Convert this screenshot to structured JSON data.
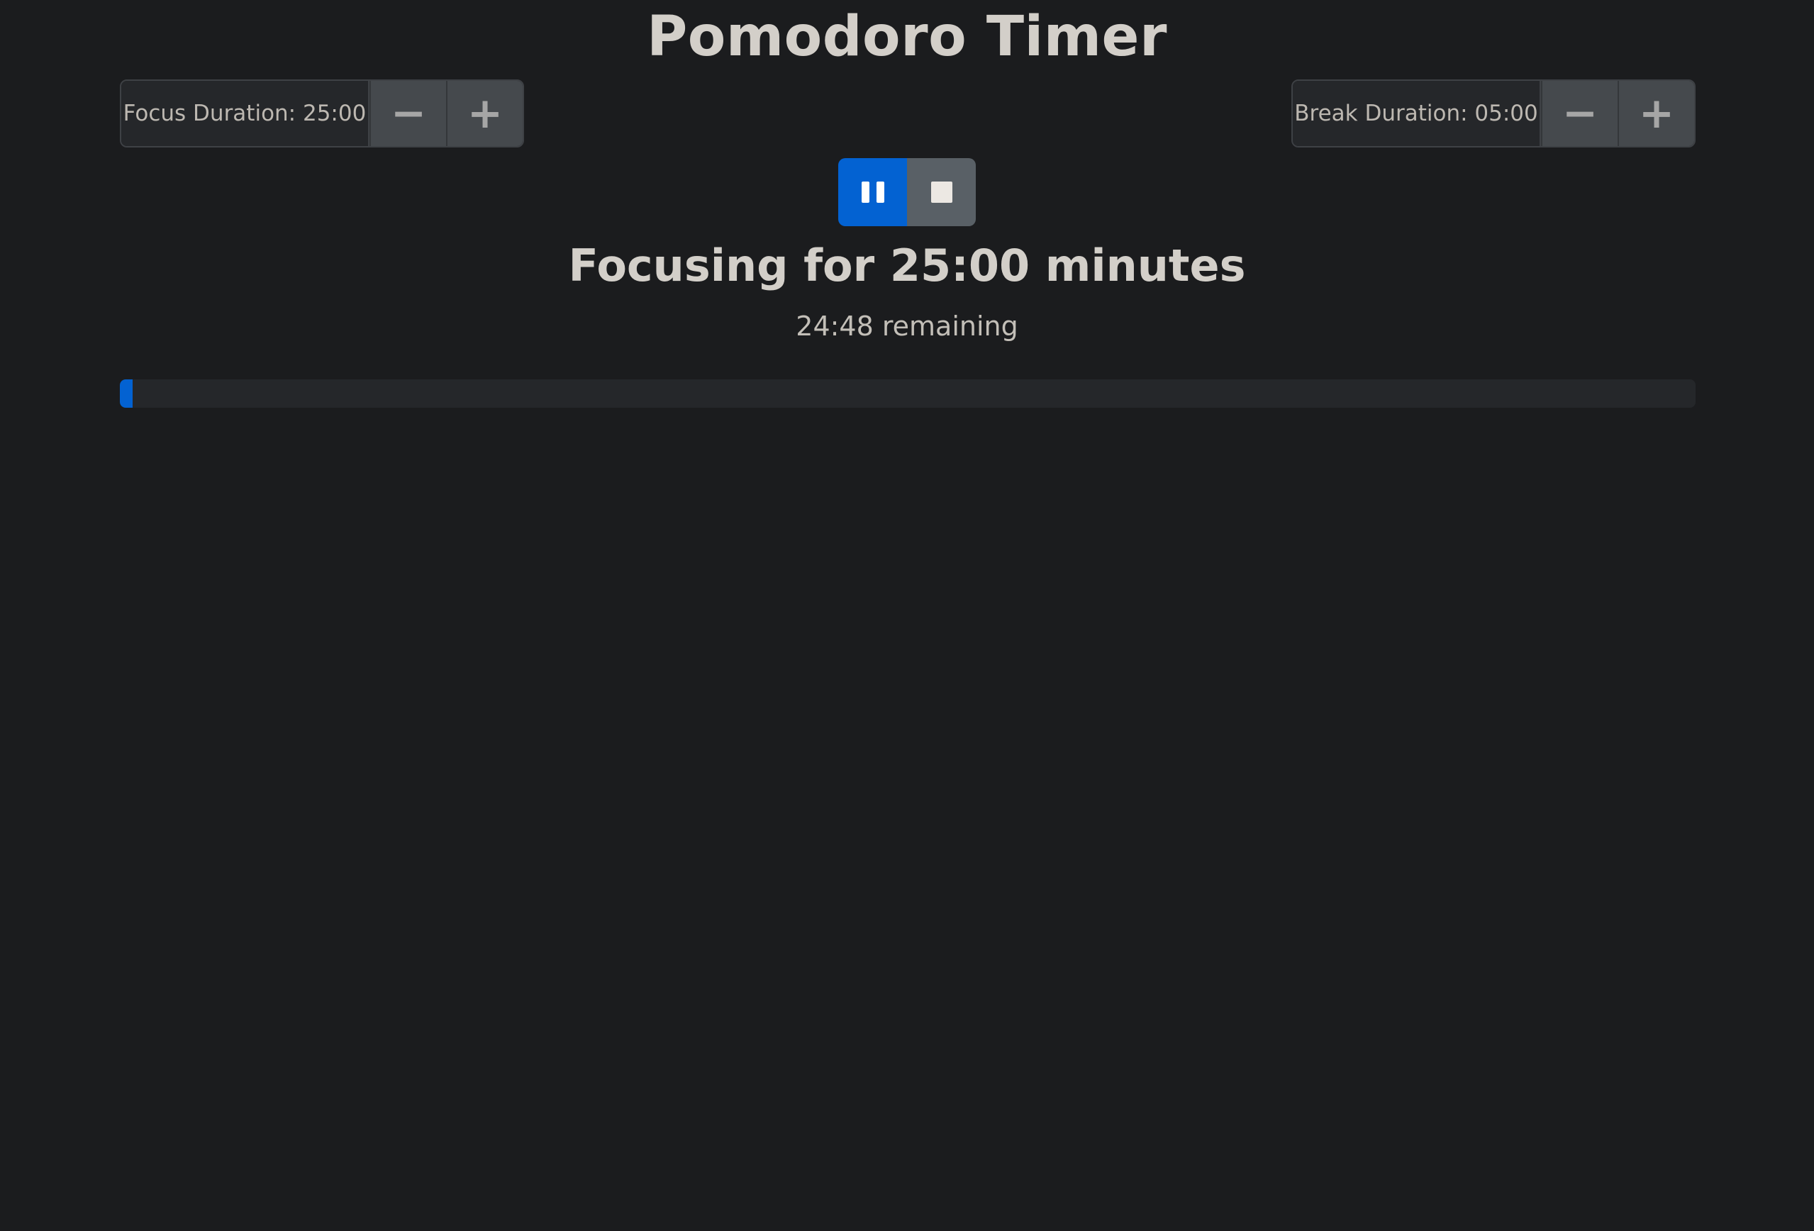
{
  "app": {
    "title": "Pomodoro Timer"
  },
  "focus": {
    "label": "Focus Duration: 25:00",
    "decrease_icon": "minus-icon",
    "increase_icon": "plus-icon"
  },
  "break": {
    "label": "Break Duration: 05:00",
    "decrease_icon": "minus-icon",
    "increase_icon": "plus-icon"
  },
  "controls": {
    "pause_icon": "pause-icon",
    "stop_icon": "stop-icon"
  },
  "status": {
    "heading": "Focusing for 25:00 minutes",
    "remaining": "24:48 remaining"
  },
  "progress": {
    "fraction": 0.008
  },
  "colors": {
    "background": "#1b1c1e",
    "accent": "#0362d2",
    "stop_button": "#596066",
    "step_button": "#45494d"
  }
}
